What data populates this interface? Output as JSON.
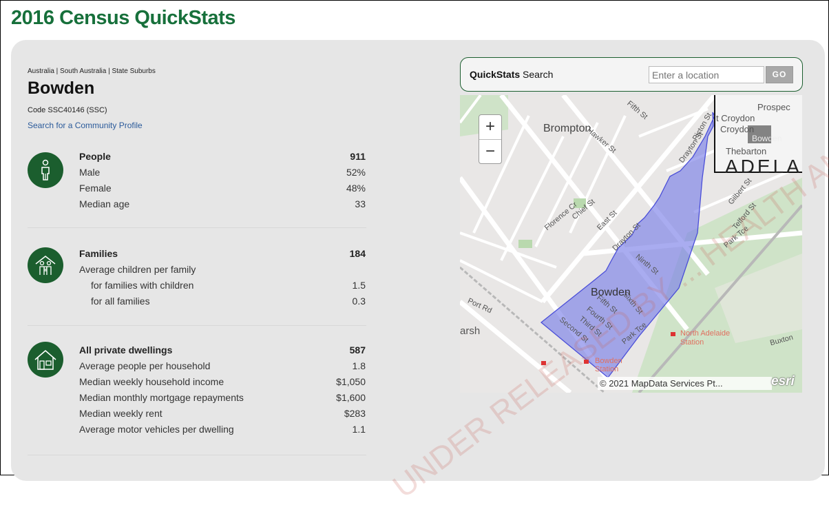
{
  "title": "2016 Census QuickStats",
  "breadcrumb": "Australia | South Australia | State Suburbs",
  "suburb": "Bowden",
  "code": "Code SSC40146 (SSC)",
  "profile_link": "Search for a Community Profile",
  "people": {
    "icon": "person-icon",
    "rows": [
      {
        "label": "People",
        "value": "911"
      },
      {
        "label": "Male",
        "value": "52%"
      },
      {
        "label": "Female",
        "value": "48%"
      },
      {
        "label": "Median age",
        "value": "33"
      }
    ]
  },
  "families": {
    "icon": "family-icon",
    "rows": [
      {
        "label": "Families",
        "value": "184"
      },
      {
        "label": "Average children per family",
        "value": ""
      },
      {
        "label": "for families with children",
        "value": "1.5"
      },
      {
        "label": "for all families",
        "value": "0.3"
      }
    ]
  },
  "dwellings": {
    "icon": "house-icon",
    "rows": [
      {
        "label": "All private dwellings",
        "value": "587"
      },
      {
        "label": "Average people per household",
        "value": "1.8"
      },
      {
        "label": "Median weekly household income",
        "value": "$1,050"
      },
      {
        "label": "Median monthly mortgage repayments",
        "value": "$1,600"
      },
      {
        "label": "Median weekly rent",
        "value": "$283"
      },
      {
        "label": "Average motor vehicles per dwelling",
        "value": "1.1"
      }
    ]
  },
  "search": {
    "title_bold": "QuickStats",
    "title_rest": " Search",
    "placeholder": "Enter a location",
    "go": "GO"
  },
  "map": {
    "zoom_in": "+",
    "zoom_out": "−",
    "attribution": "© 2021 MapData Services Pt...",
    "esri": "esri",
    "labels": {
      "brompton": "Brompton",
      "bowden": "Bowden",
      "croydon": "t Croydon",
      "croydon2": "Croydon",
      "prospect": "Prospec",
      "thebarton": "Thebarton",
      "adela": "ADELA",
      "bowden_inset": "Bowden",
      "arsh": "arsh",
      "north_adelaide": "North Adelaide",
      "station": "Station",
      "bowden_station": "Bowden",
      "bowden_station2": "Station",
      "buxton": "Buxton",
      "second_st": "Second St",
      "third_st": "Third St",
      "fourth_st": "Fourth St",
      "fifth_st": "Fifth St",
      "sixth_st": "Sixth St",
      "ninth_st": "Ninth St",
      "drayton_st": "Drayton St",
      "east_st": "East St",
      "park_tce": "Park Tce",
      "park_tce2": "Park Tce",
      "chief_st": "Chief St",
      "florence_cr": "Florence Cr",
      "gilbert_st": "Gilbert St",
      "telford_st": "Telford St",
      "port_rd": "Port Rd",
      "hawker_st": "Hawker St",
      "fifth_st2": "Fifth St",
      "picton_st": "Picton St",
      "drayton_st2": "Drayton St"
    },
    "region_color": "#7b7fe8"
  },
  "watermark": "UNDER RELEASED BY ... HEALTH AND AGED CARE"
}
